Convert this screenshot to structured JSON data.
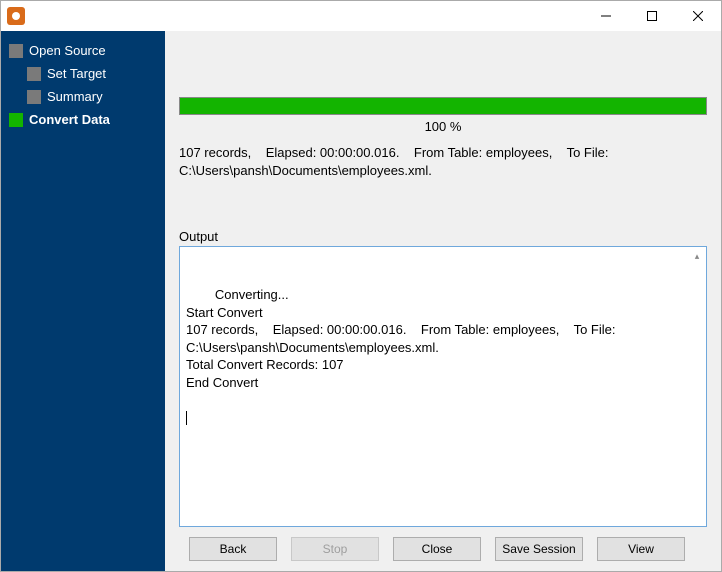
{
  "sidebar": {
    "items": [
      {
        "label": "Open Source",
        "active": false,
        "indent": 0
      },
      {
        "label": "Set Target",
        "active": false,
        "indent": 1
      },
      {
        "label": "Summary",
        "active": false,
        "indent": 1
      },
      {
        "label": "Convert Data",
        "active": true,
        "indent": 0
      }
    ]
  },
  "progress": {
    "percent_label": "100 %"
  },
  "status": {
    "text": "107 records,    Elapsed: 00:00:00.016.    From Table: employees,    To File: C:\\Users\\pansh\\Documents\\employees.xml."
  },
  "output": {
    "label": "Output",
    "log": "Converting...\nStart Convert\n107 records,    Elapsed: 00:00:00.016.    From Table: employees,    To File: C:\\Users\\pansh\\Documents\\employees.xml.\nTotal Convert Records: 107\nEnd Convert"
  },
  "buttons": {
    "back": "Back",
    "stop": "Stop",
    "close": "Close",
    "save_session": "Save Session",
    "view": "View"
  }
}
